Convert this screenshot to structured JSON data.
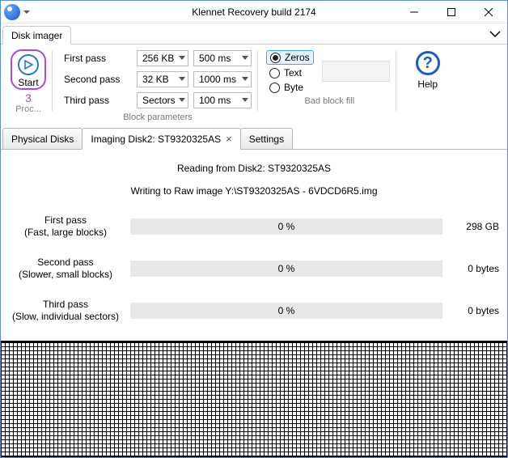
{
  "window": {
    "title": "Klennet Recovery build 2174"
  },
  "top_tab": {
    "label": "Disk imager"
  },
  "ribbon": {
    "start": {
      "label": "Start",
      "step_number": "3",
      "step_caption": "Proc..."
    },
    "block_params": {
      "group_title": "Block parameters",
      "rows": [
        {
          "label": "First pass",
          "size": "256 KB",
          "delay": "500 ms"
        },
        {
          "label": "Second pass",
          "size": "32 KB",
          "delay": "1000 ms"
        },
        {
          "label": "Third pass",
          "size": "Sectors",
          "delay": "100 ms"
        }
      ]
    },
    "fill": {
      "group_title": "Bad block fill",
      "options": [
        "Zeros",
        "Text",
        "Byte"
      ],
      "selected": "Zeros"
    },
    "help": {
      "label": "Help"
    }
  },
  "doc_tabs": {
    "physical": "Physical Disks",
    "imaging": "Imaging Disk2:  ST9320325AS",
    "settings": "Settings"
  },
  "status": {
    "reading": "Reading from Disk2:  ST9320325AS",
    "writing": "Writing to Raw image Y:\\ST9320325AS - 6VDCD6R5.img"
  },
  "passes": [
    {
      "title": "First pass",
      "sub": "(Fast, large blocks)",
      "pct": "0 %",
      "size": "298 GB"
    },
    {
      "title": "Second pass",
      "sub": "(Slower, small blocks)",
      "pct": "0 %",
      "size": "0 bytes"
    },
    {
      "title": "Third pass",
      "sub": "(Slow, individual sectors)",
      "pct": "0 %",
      "size": "0 bytes"
    }
  ]
}
